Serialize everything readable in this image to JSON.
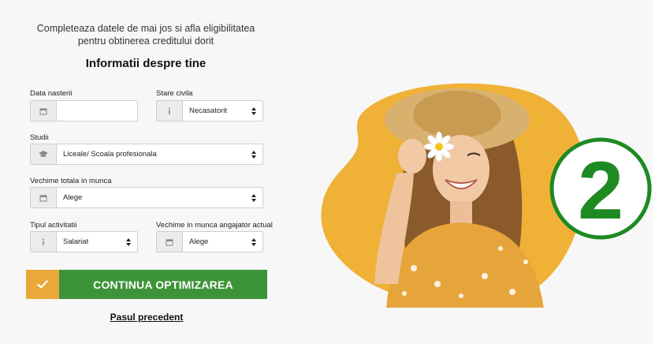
{
  "form": {
    "intro_text": "Completeaza datele de mai jos si afla eligibilitatea pentru obtinerea creditului dorit",
    "heading": "Informatii despre tine",
    "fields": {
      "birth_date": {
        "label": "Data nasterii",
        "value": "",
        "icon": "calendar-icon"
      },
      "civil_status": {
        "label": "Stare civila",
        "value": "Necasatorit",
        "icon": "info-icon"
      },
      "education": {
        "label": "Studii",
        "value": "Liceale/ Scoala profesionala",
        "icon": "graduation-cap-icon"
      },
      "total_work_seniority": {
        "label": "Vechime totala in munca",
        "value": "Alege",
        "icon": "calendar-icon"
      },
      "activity_type": {
        "label": "Tipul activitatii",
        "value": "Salariat",
        "icon": "info-icon"
      },
      "current_employer_seniority": {
        "label": "Vechime in munca angajator actual",
        "value": "Alege",
        "icon": "calendar-icon"
      }
    },
    "continue_button": {
      "label": "CONTINUA OPTIMIZAREA",
      "icon": "checkmark-icon"
    },
    "previous_link": "Pasul precedent"
  },
  "illustration": {
    "description_icon": "smiling-woman-photo",
    "step_number": "2"
  },
  "colors": {
    "accent_orange": "#e9a93a",
    "cta_green": "#3d9438",
    "badge_green": "#1e8a22",
    "blob_yellow": "#efb136"
  }
}
